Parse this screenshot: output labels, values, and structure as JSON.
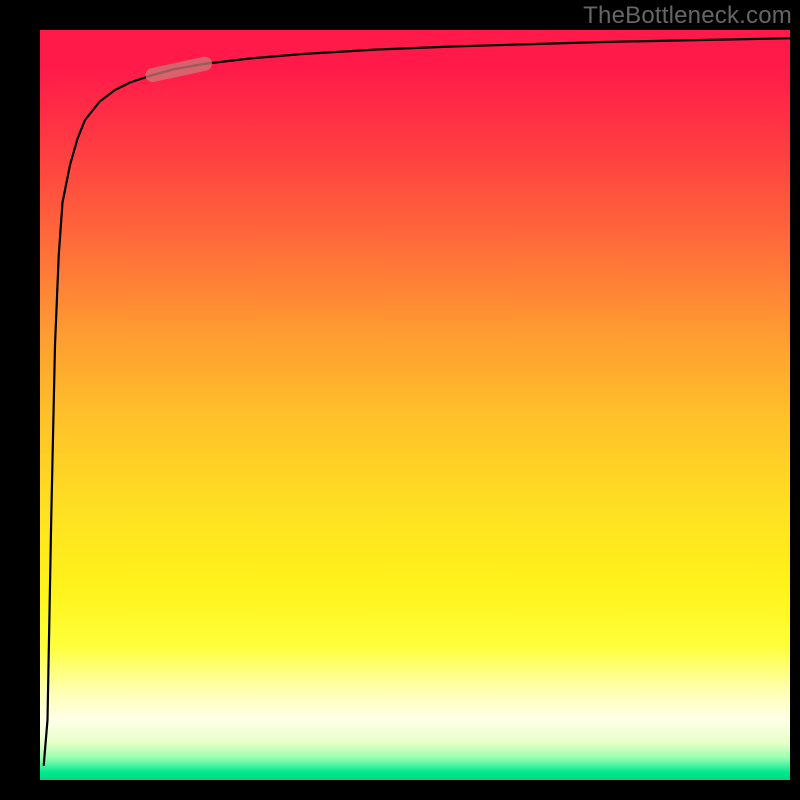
{
  "chart_data": {
    "type": "line",
    "title": "",
    "xlabel": "",
    "ylabel": "",
    "watermark": "TheBottleneck.com",
    "xlim": [
      0,
      100
    ],
    "ylim": [
      0,
      100
    ],
    "grid": false,
    "legend": false,
    "gradient_stops": [
      {
        "pos": 0,
        "color": "#ff1a4a"
      },
      {
        "pos": 50,
        "color": "#ffc22a"
      },
      {
        "pos": 82,
        "color": "#ffff3a"
      },
      {
        "pos": 100,
        "color": "#00d880"
      }
    ],
    "series": [
      {
        "name": "curve",
        "x": [
          0.5,
          1,
          1.5,
          2,
          2.5,
          3,
          4,
          5,
          6,
          8,
          10,
          12,
          15,
          18,
          22,
          28,
          35,
          45,
          55,
          65,
          75,
          85,
          95,
          100
        ],
        "y": [
          2,
          8,
          35,
          58,
          70,
          77,
          82,
          85.5,
          88,
          90.5,
          92,
          93,
          94,
          94.8,
          95.5,
          96.2,
          96.8,
          97.4,
          97.8,
          98.1,
          98.4,
          98.6,
          98.8,
          98.9
        ]
      }
    ],
    "highlight_segment": {
      "name": "indicator",
      "color": "#cc7a7a",
      "x": [
        15,
        22
      ],
      "y": [
        94,
        95.5
      ]
    },
    "colors": {
      "curve": "#000000",
      "highlight": "#cc7a7a",
      "frame": "#000000",
      "watermark": "#666666"
    }
  }
}
